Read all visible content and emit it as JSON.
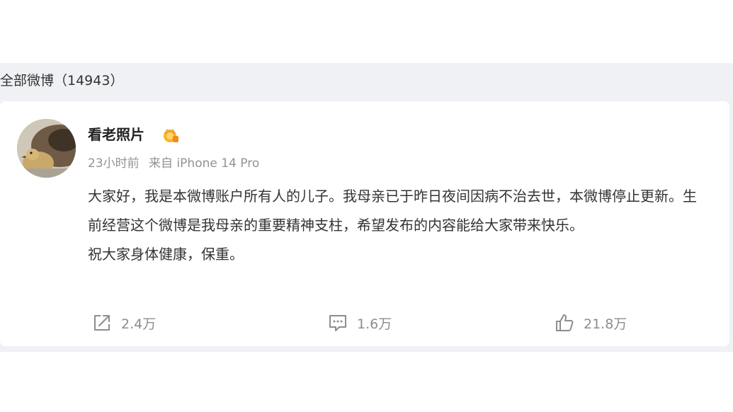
{
  "feed": {
    "header": "全部微博（14943）"
  },
  "post": {
    "user": {
      "name": "看老照片",
      "badge_icon": "crown-vip-badge-icon"
    },
    "meta": {
      "time": "23小时前",
      "source": "来自 iPhone 14 Pro"
    },
    "content": {
      "paragraph1": "大家好，我是本微博账户所有人的儿子。我母亲已于昨日夜间因病不治去世，本微博停止更新。生前经营这个微博是我母亲的重要精神支柱，希望发布的内容能给大家带来快乐。",
      "paragraph2": "祝大家身体健康，保重。"
    },
    "actions": {
      "repost": {
        "icon": "share-icon",
        "count": "2.4万"
      },
      "comment": {
        "icon": "comment-icon",
        "count": "1.6万"
      },
      "like": {
        "icon": "thumbs-up-icon",
        "count": "21.8万"
      }
    }
  },
  "colors": {
    "band_background": "#f0f1f4",
    "card_background": "#ffffff",
    "text_primary": "#333333",
    "text_secondary": "#939393",
    "badge_gold": "#f5b52a"
  }
}
